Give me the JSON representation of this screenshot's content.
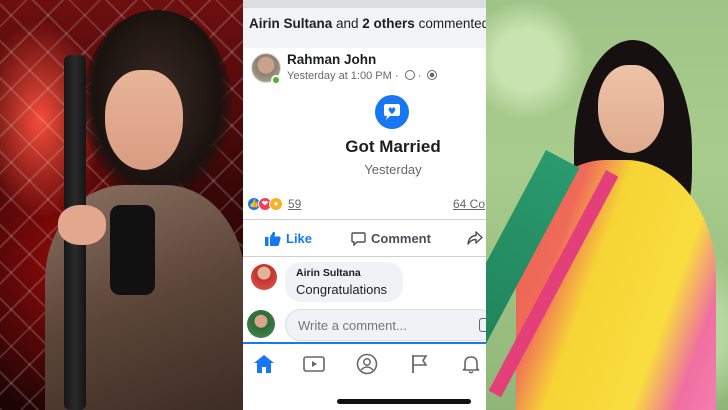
{
  "phone": {
    "commenters_bar": {
      "name": "Airin Sultana",
      "connector": " and ",
      "others": "2 others",
      "suffix": " commented"
    },
    "post": {
      "author": "Rahman John",
      "timestamp": "Yesterday at 1:00 PM",
      "separator": " · ",
      "icons": [
        "clock-icon",
        "globe-icon"
      ]
    },
    "life_event": {
      "icon": "heart-bubble-icon",
      "title": "Got Married",
      "date": "Yesterday"
    },
    "reactions": {
      "types": [
        "like",
        "love",
        "wow"
      ],
      "count": "59",
      "comments": "64 Co"
    },
    "actions": {
      "like": "Like",
      "comment": "Comment"
    },
    "comment": {
      "author": "Airin Sultana",
      "text": "Congratulations"
    },
    "composer": {
      "placeholder": "Write a comment..."
    },
    "nav": [
      "home-icon",
      "watch-icon",
      "profile-icon",
      "pages-flag-icon",
      "notifications-bell-icon"
    ]
  },
  "colors": {
    "accent": "#1877f2",
    "love": "#f33e58",
    "wow": "#f7b125",
    "online": "#42b72a"
  }
}
